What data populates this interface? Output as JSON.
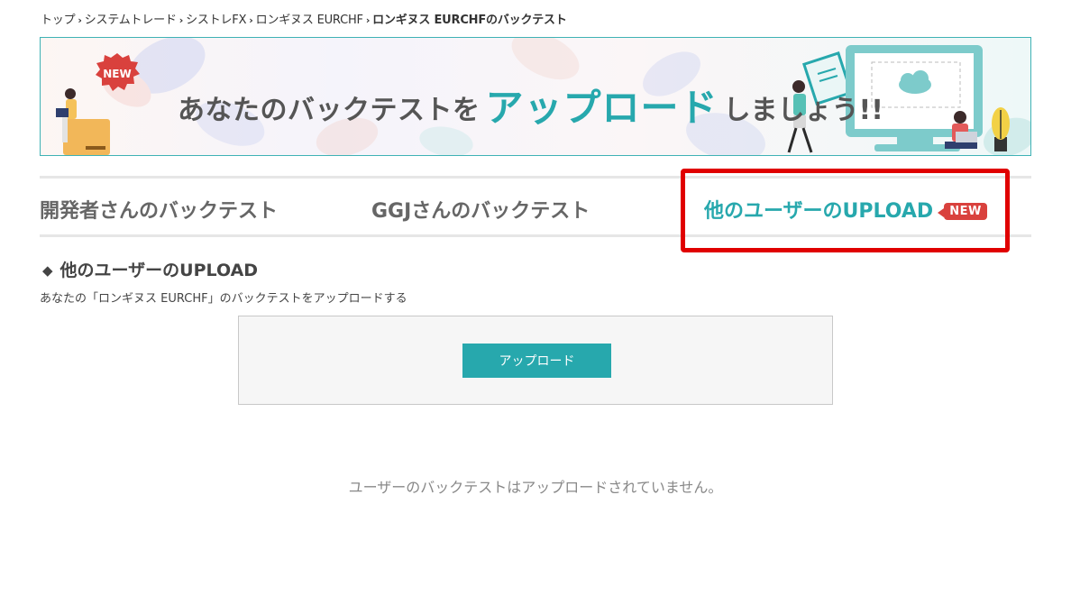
{
  "breadcrumb": {
    "items": [
      "トップ",
      "システムトレード",
      "シストレFX",
      "ロンギヌス EURCHF"
    ],
    "current": "ロンギヌス EURCHFのバックテスト",
    "separator": "›"
  },
  "banner": {
    "new_badge": "NEW",
    "text_prefix": "あなたのバックテストを",
    "text_highlight": "アップロード",
    "text_suffix": "しましょう!!"
  },
  "tabs": [
    {
      "label": "開発者さんのバックテスト"
    },
    {
      "label": "GGJさんのバックテスト"
    },
    {
      "label": "他のユーザーのUPLOAD",
      "badge": "NEW"
    }
  ],
  "section": {
    "marker": "◆",
    "title": "他のユーザーのUPLOAD",
    "description": "あなたの「ロンギヌス EURCHF」のバックテストをアップロードする"
  },
  "upload": {
    "button_label": "アップロード"
  },
  "empty_message": "ユーザーのバックテストはアップロードされていません。",
  "colors": {
    "accent": "#27a8ad",
    "badge": "#d9413d",
    "highlight_border": "#e00000"
  }
}
